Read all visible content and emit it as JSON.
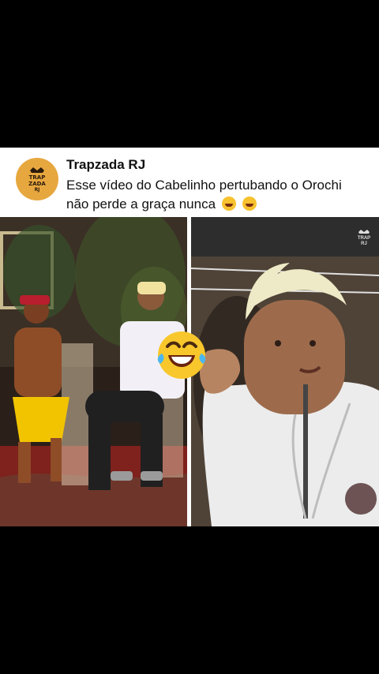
{
  "post": {
    "account_name": "Trapzada RJ",
    "avatar_text": "TRAP\nZADA\nRJ",
    "caption": "Esse vídeo do Cabelinho pertubando o Orochi não perde a graça nunca",
    "caption_emojis": [
      "rofl-emoji",
      "rofl-emoji"
    ],
    "overlay_emoji": "laughing-tears-emoji",
    "right_watermark": "TRAP\nRJ"
  },
  "colors": {
    "background": "#000000",
    "card": "#ffffff",
    "avatar": "#e7a73f",
    "text": "#111111"
  }
}
